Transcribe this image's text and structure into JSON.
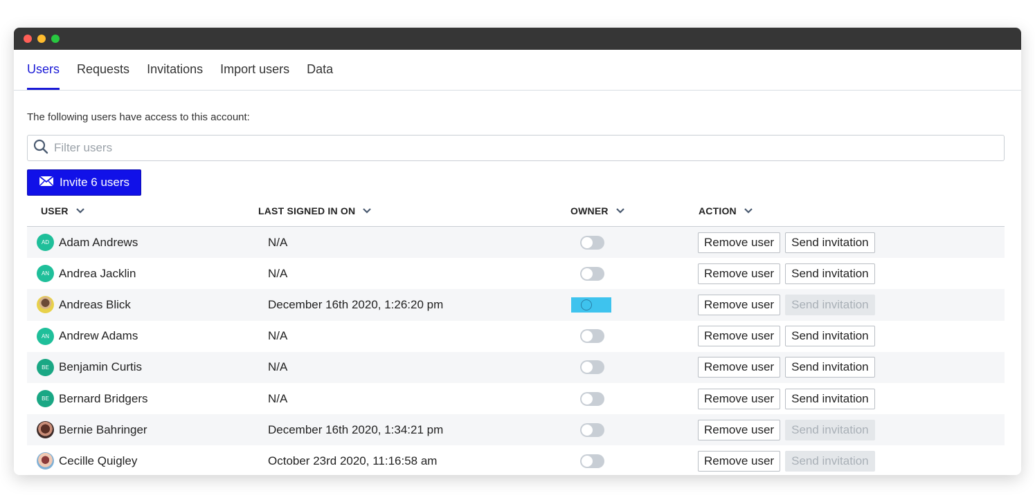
{
  "window": {
    "dots": [
      "#ff5f57",
      "#febc2e",
      "#28c840"
    ]
  },
  "tabs": [
    {
      "label": "Users",
      "active": true
    },
    {
      "label": "Requests",
      "active": false
    },
    {
      "label": "Invitations",
      "active": false
    },
    {
      "label": "Import users",
      "active": false
    },
    {
      "label": "Data",
      "active": false
    }
  ],
  "intro": "The following users have access to this account:",
  "search": {
    "placeholder": "Filter users",
    "value": "",
    "icon": "search-icon"
  },
  "invite_button": {
    "label": "Invite 6 users",
    "icon": "envelope-icon"
  },
  "columns": {
    "user": "USER",
    "last_signed_in": "LAST SIGNED IN ON",
    "owner": "OWNER",
    "action": "ACTION"
  },
  "actions": {
    "remove": "Remove user",
    "send": "Send invitation"
  },
  "users": [
    {
      "name": "Adam Andrews",
      "initials": "AD",
      "last": "N/A",
      "owner": false,
      "send_enabled": true
    },
    {
      "name": "Andrea Jacklin",
      "initials": "AN",
      "last": "N/A",
      "owner": false,
      "send_enabled": true
    },
    {
      "name": "Andreas Blick",
      "initials": "",
      "last": "December 16th 2020, 1:26:20 pm",
      "owner": false,
      "send_enabled": false
    },
    {
      "name": "Andrew Adams",
      "initials": "AN",
      "last": "N/A",
      "owner": false,
      "send_enabled": true
    },
    {
      "name": "Benjamin Curtis",
      "initials": "BE",
      "last": "N/A",
      "owner": false,
      "send_enabled": true
    },
    {
      "name": "Bernard Bridgers",
      "initials": "BE",
      "last": "N/A",
      "owner": false,
      "send_enabled": true
    },
    {
      "name": "Bernie Bahringer",
      "initials": "",
      "last": "December 16th 2020, 1:34:21 pm",
      "owner": false,
      "send_enabled": false
    },
    {
      "name": "Cecille Quigley",
      "initials": "",
      "last": "October 23rd 2020, 11:16:58 am",
      "owner": false,
      "send_enabled": false
    }
  ]
}
